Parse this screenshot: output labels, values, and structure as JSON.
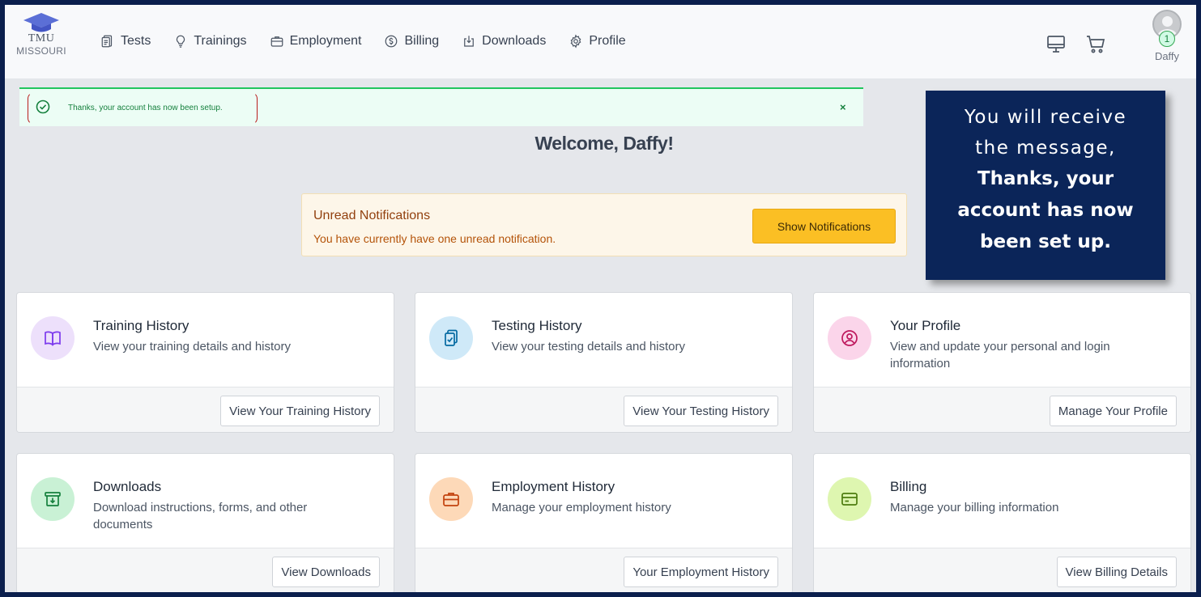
{
  "logo": {
    "line1": "TMU",
    "line2": "MISSOURI"
  },
  "nav": [
    {
      "label": "Tests",
      "icon": "clipboard-icon"
    },
    {
      "label": "Trainings",
      "icon": "lightbulb-icon"
    },
    {
      "label": "Employment",
      "icon": "briefcase-icon"
    },
    {
      "label": "Billing",
      "icon": "dollar-icon"
    },
    {
      "label": "Downloads",
      "icon": "download-icon"
    },
    {
      "label": "Profile",
      "icon": "gear-icon"
    }
  ],
  "user": {
    "name": "Daffy",
    "badge_count": "1"
  },
  "alert": {
    "message": "Thanks, your account has now been setup.",
    "close": "×"
  },
  "welcome": "Welcome, Daffy!",
  "notifications": {
    "title": "Unread Notifications",
    "text": "You have currently have one unread notification.",
    "button": "Show Notifications"
  },
  "callout": {
    "line1": "You will receive",
    "line2": "the message,",
    "line3": "Thanks, your",
    "line4": "account has now",
    "line5": "been set up."
  },
  "cards": [
    {
      "title": "Training History",
      "desc": "View your training details and history",
      "button": "View Your Training History",
      "icon": "book-icon",
      "color": "#ede0fb"
    },
    {
      "title": "Testing History",
      "desc": "View your testing details and history",
      "button": "View Your Testing History",
      "icon": "clipboard-check-icon",
      "color": "#cfe9f8"
    },
    {
      "title": "Your Profile",
      "desc": "View and update your personal and login information",
      "button": "Manage Your Profile",
      "icon": "user-circle-icon",
      "color": "#fbd5ea"
    },
    {
      "title": "Downloads",
      "desc": "Download instructions, forms, and other documents",
      "button": "View Downloads",
      "icon": "archive-icon",
      "color": "#c9f1d5"
    },
    {
      "title": "Employment History",
      "desc": "Manage your employment history",
      "button": "Your Employment History",
      "icon": "briefcase-icon",
      "color": "#fdd9b8"
    },
    {
      "title": "Billing",
      "desc": "Manage your billing information",
      "button": "View Billing Details",
      "icon": "credit-card-icon",
      "color": "#def6b0"
    }
  ]
}
